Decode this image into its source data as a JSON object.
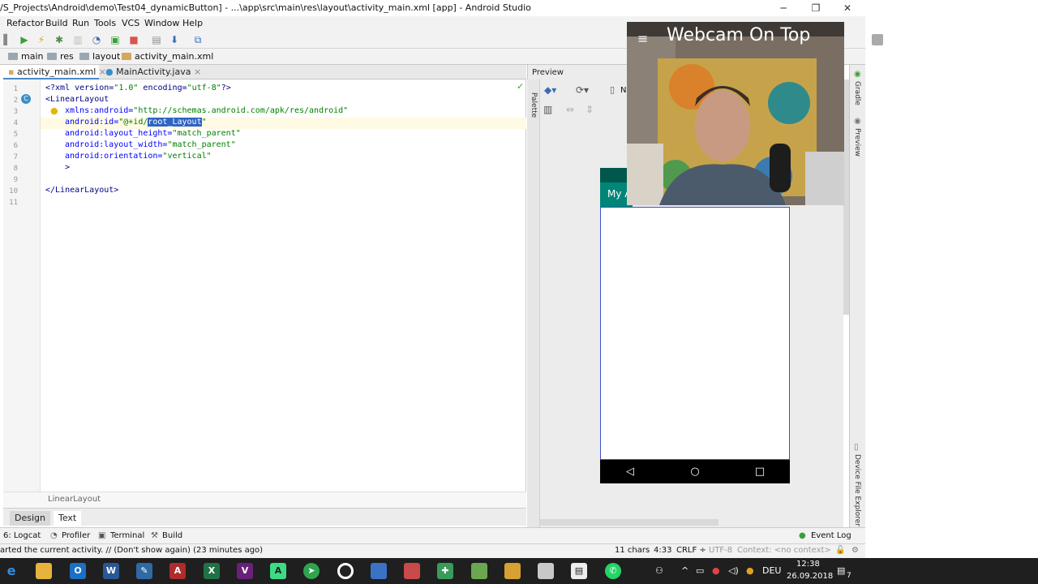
{
  "window": {
    "title": "/S_Projects\\Android\\demo\\Test04_dynamicButton] - ...\\app\\src\\main\\res\\layout\\activity_main.xml [app] - Android Studio",
    "minimize": "─",
    "maximize": "❐",
    "close": "✕"
  },
  "menu": [
    "Refactor",
    "Build",
    "Run",
    "Tools",
    "VCS",
    "Window",
    "Help"
  ],
  "breadcrumb": [
    "main",
    "res",
    "layout",
    "activity_main.xml"
  ],
  "tabs": [
    {
      "label": "activity_main.xml",
      "close": "×"
    },
    {
      "label": "MainActivity.java",
      "close": "×"
    }
  ],
  "editor": {
    "line_numbers": [
      "1",
      "2",
      "3",
      "4",
      "5",
      "6",
      "7",
      "8",
      "9",
      "10",
      "11"
    ],
    "l1_a": "<?xml version=",
    "l1_b": "\"1.0\"",
    "l1_c": " encoding=",
    "l1_d": "\"utf-8\"",
    "l1_e": "?>",
    "l2": "<LinearLayout",
    "l3_attr": "xmlns:android=",
    "l3_val": "\"http://schemas.android.com/apk/res/android\"",
    "l4_attr": "android:id=",
    "l4_val1": "\"@+id/",
    "l4_sel": "root_Layout",
    "l4_val2": "\"",
    "l5_attr": "android:layout_height=",
    "l5_val": "\"match_parent\"",
    "l6_attr": "android:layout_width=",
    "l6_val": "\"match_parent\"",
    "l7_attr": "android:orientation=",
    "l7_val": "\"vertical\"",
    "l8": ">",
    "l10": "</LinearLayout>",
    "footer": "LinearLayout",
    "check_mark": "✓"
  },
  "design_tabs": {
    "design": "Design",
    "text": "Text"
  },
  "preview": {
    "title": "Preview",
    "palette": "Palette",
    "app_title": "My A",
    "toolbar_n": "N"
  },
  "webcam": {
    "title": "Webcam On Top",
    "menu": "≡"
  },
  "side_tabs": {
    "gradle": "Gradle",
    "preview": "Preview",
    "device": "Device File Explorer"
  },
  "tool_windows": [
    "6: Logcat",
    "Profiler",
    "Terminal",
    "Build"
  ],
  "event_log": "Event Log",
  "status": {
    "message": "arted the current activity. // (Don't show again) (23 minutes ago)",
    "chars": "11 chars",
    "pos": "4:33",
    "crlf": "CRLF ÷",
    "encoding": "UTF-8",
    "context": "Context: <no context>"
  },
  "taskbar": {
    "lang": "DEU",
    "time": "12:38",
    "date": "26.09.2018",
    "notify": "7"
  }
}
